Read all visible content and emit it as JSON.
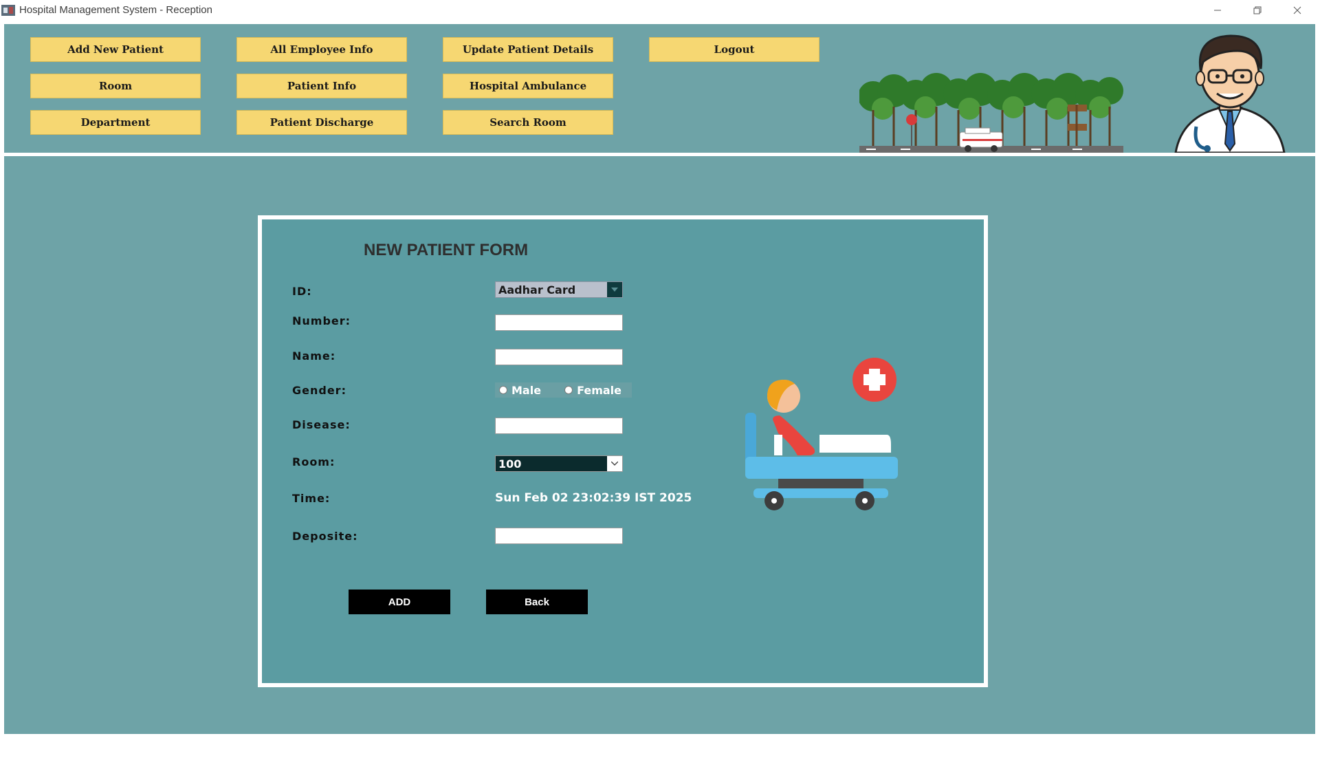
{
  "window": {
    "title": "Hospital Management System - Reception",
    "icon": "hospital-app-icon",
    "controls": [
      "minimize-icon",
      "restore-icon",
      "close-icon"
    ]
  },
  "nav": {
    "add_new_patient": "Add New Patient",
    "all_employee_info": "All Employee Info",
    "update_patient_details": "Update Patient Details",
    "logout": "Logout",
    "room": "Room",
    "patient_info": "Patient Info",
    "hospital_ambulance": "Hospital Ambulance",
    "department": "Department",
    "patient_discharge": "Patient Discharge",
    "search_room": "Search Room"
  },
  "form": {
    "title": "NEW PATIENT FORM",
    "labels": {
      "id": "ID:",
      "number": "Number:",
      "name": "Name:",
      "gender": "Gender:",
      "disease": "Disease:",
      "room": "Room:",
      "time": "Time:",
      "deposite": "Deposite:"
    },
    "id_type": "Aadhar Card",
    "number": "",
    "name": "",
    "gender_options": {
      "male": "Male",
      "female": "Female"
    },
    "disease": "",
    "room": "100",
    "time": "Sun Feb 02 23:02:39 IST 2025",
    "deposite": "",
    "add_button": "ADD",
    "back_button": "Back"
  },
  "colors": {
    "panel": "#6ea3a7",
    "form": "#5b9ca2",
    "nav_button": "#f6d772",
    "action_button": "#000000"
  }
}
